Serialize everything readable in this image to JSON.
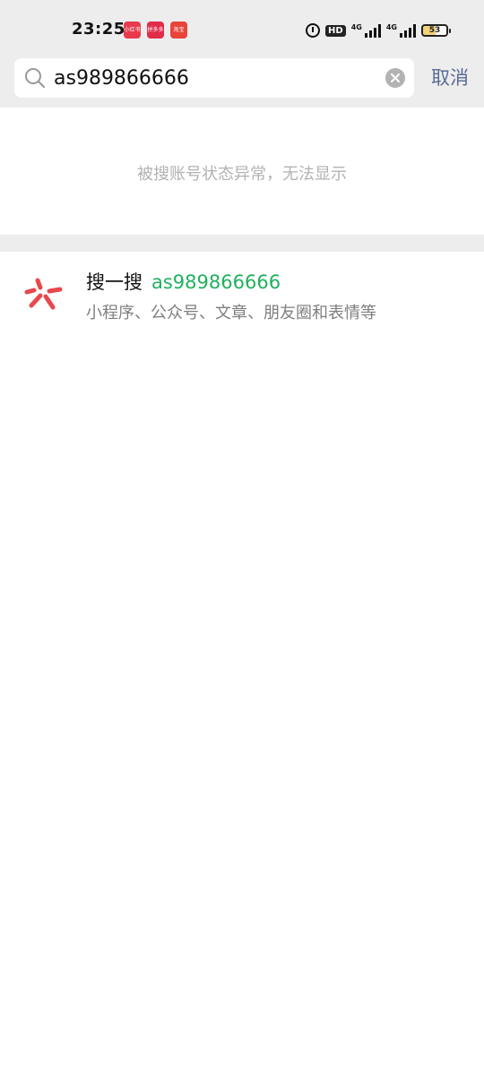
{
  "status_bar": {
    "time": "23:25",
    "app_icons": [
      "小红书",
      "拼多多",
      "淘宝"
    ],
    "hd_label": "HD",
    "signal_1_label": "4G",
    "signal_2_label": "4G",
    "battery_level": "53"
  },
  "search": {
    "query": "as989866666",
    "cancel_label": "取消"
  },
  "notice": {
    "text": "被搜账号状态异常，无法显示"
  },
  "sou_yi_sou": {
    "title": "搜一搜",
    "keyword": "as989866666",
    "subtitle": "小程序、公众号、文章、朋友圈和表情等",
    "icon_color": "#e8474c",
    "keyword_color": "#20b15e"
  },
  "colors": {
    "background_gray": "#ededed",
    "link_blue": "#576b95",
    "hint_gray": "#b2b2b2"
  }
}
